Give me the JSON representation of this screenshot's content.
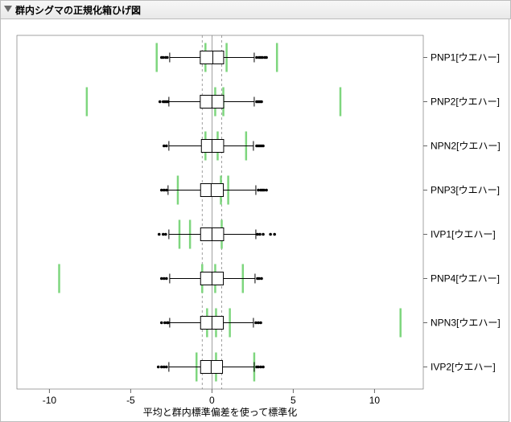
{
  "header": {
    "title": "群内シグマの正規化箱ひげ図"
  },
  "axis": {
    "x_label": "平均と群内標準偏差を使って標準化",
    "ticks": [
      -10,
      -5,
      0,
      5,
      10
    ]
  },
  "ref_lines": {
    "solid": [
      0
    ],
    "dashed": [
      -0.6,
      0.6
    ]
  },
  "chart_data": {
    "type": "box",
    "xlim": [
      -12,
      13
    ],
    "categories": [
      "PNP1[ウエハー]",
      "PNP2[ウエハー]",
      "NPN2[ウエハー]",
      "PNP3[ウエハー]",
      "IVP1[ウエハー]",
      "PNP4[ウエハー]",
      "NPN3[ウエハー]",
      "IVP2[ウエハー]"
    ],
    "series": [
      {
        "name": "PNP1[ウエハー]",
        "box": {
          "q1": -0.72,
          "med": 0.05,
          "q3": 0.72
        },
        "whisker": [
          -2.6,
          2.6
        ],
        "outliers": [
          -3.1,
          -3.0,
          -2.85,
          -2.75,
          2.75,
          2.9,
          3.0,
          3.1,
          3.25,
          3.35
        ],
        "green": [
          -3.4,
          -0.4,
          0.9,
          4.0
        ]
      },
      {
        "name": "PNP2[ウエハー]",
        "box": {
          "q1": -0.72,
          "med": 0.0,
          "q3": 0.72
        },
        "whisker": [
          -2.65,
          2.6
        ],
        "outliers": [
          -3.2,
          -3.0,
          -2.9,
          -2.8,
          -2.7,
          2.75,
          2.85,
          2.95,
          3.05
        ],
        "green": [
          -7.7,
          0.2,
          0.7,
          7.9
        ]
      },
      {
        "name": "NPN2[ウエハー]",
        "box": {
          "q1": -0.65,
          "med": 0.0,
          "q3": 0.72
        },
        "whisker": [
          -2.65,
          2.55
        ],
        "outliers": [
          -2.95,
          -2.8,
          2.75,
          2.85,
          2.95,
          3.05,
          3.15
        ],
        "green": [
          -0.4,
          0.35,
          2.1
        ]
      },
      {
        "name": "PNP3[ウエハー]",
        "box": {
          "q1": -0.7,
          "med": -0.05,
          "q3": 0.7
        },
        "whisker": [
          -2.7,
          2.7
        ],
        "outliers": [
          -3.1,
          -2.95,
          -2.8,
          2.85,
          3.0,
          3.1,
          3.2,
          3.35
        ],
        "green": [
          -2.1,
          0.55,
          1.0
        ]
      },
      {
        "name": "IVP1[ウエハー]",
        "box": {
          "q1": -0.7,
          "med": 0.0,
          "q3": 0.72
        },
        "whisker": [
          -2.65,
          2.7
        ],
        "outliers": [
          -3.25,
          -3.0,
          -2.85,
          2.8,
          2.95,
          3.15,
          3.6,
          3.85
        ],
        "green": [
          -2.0,
          -1.35,
          0.6
        ]
      },
      {
        "name": "PNP4[ウエハー]",
        "box": {
          "q1": -0.7,
          "med": 0.0,
          "q3": 0.7
        },
        "whisker": [
          -2.6,
          2.65
        ],
        "outliers": [
          -3.1,
          -2.95,
          -2.8,
          2.8,
          2.9,
          3.05
        ],
        "green": [
          -9.4,
          -0.6,
          0.2,
          1.9
        ]
      },
      {
        "name": "NPN3[ウエハー]",
        "box": {
          "q1": -0.7,
          "med": 0.0,
          "q3": 0.7
        },
        "whisker": [
          -2.6,
          2.55
        ],
        "outliers": [
          -3.1,
          -2.9,
          -2.75,
          -2.7,
          2.7,
          2.85,
          3.0
        ],
        "green": [
          -0.3,
          0.25,
          1.1,
          11.6
        ]
      },
      {
        "name": "IVP2[ウエハー]",
        "box": {
          "q1": -0.7,
          "med": -0.05,
          "q3": 0.65
        },
        "whisker": [
          -2.65,
          2.6
        ],
        "outliers": [
          -3.3,
          -3.1,
          -2.95,
          -2.8,
          2.75,
          2.85,
          3.0,
          3.15
        ],
        "green": [
          -0.95,
          0.25,
          2.6
        ]
      }
    ]
  }
}
